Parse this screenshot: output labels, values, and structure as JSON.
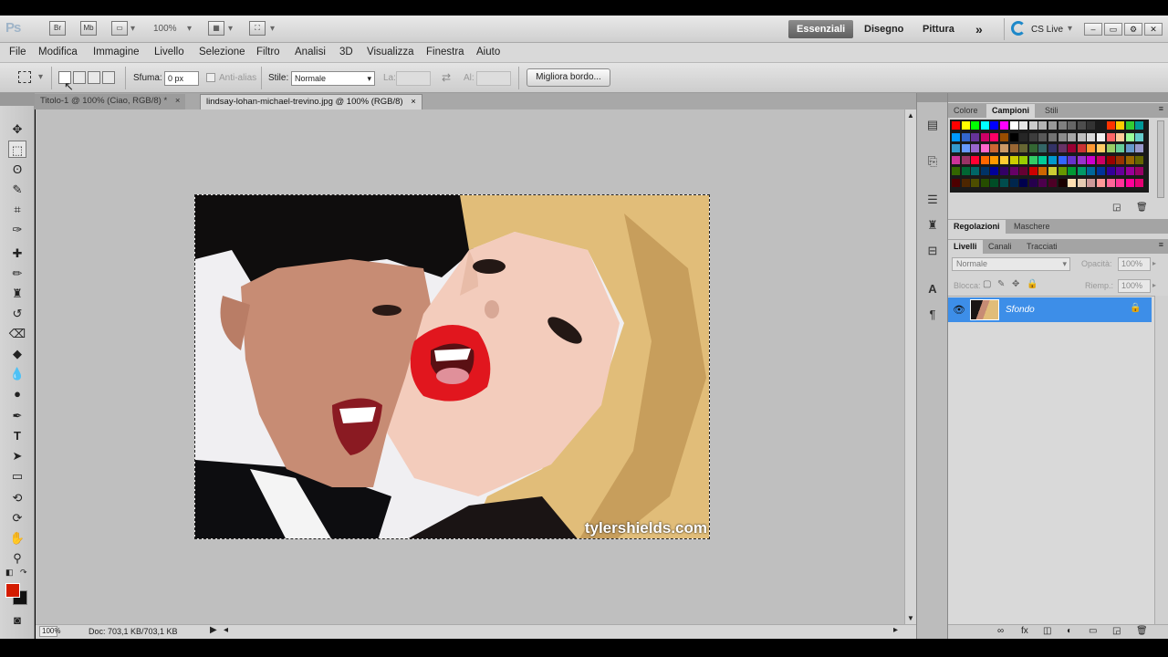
{
  "app": {
    "logo": "Ps",
    "zoom": "100%",
    "workspaces": [
      "Essenziali",
      "Disegno",
      "Pittura"
    ],
    "more": "»",
    "cs_live": "CS Live",
    "icons": [
      "bridge-icon",
      "mini-bridge-icon",
      "screen-mode-icon",
      "arrange-icon",
      "extras-icon"
    ]
  },
  "menu": [
    "File",
    "Modifica",
    "Immagine",
    "Livello",
    "Selezione",
    "Filtro",
    "Analisi",
    "3D",
    "Visualizza",
    "Finestra",
    "Aiuto"
  ],
  "options": {
    "feather_label": "Sfuma:",
    "feather_value": "0 px",
    "antialias_label": "Anti-alias",
    "style_label": "Stile:",
    "style_value": "Normale",
    "width_label": "La:",
    "height_label": "Al:",
    "refine_button": "Migliora bordo..."
  },
  "tabs": [
    {
      "label": "Titolo-1 @ 100% (Ciao, RGB/8) *",
      "close": "×"
    },
    {
      "label": "lindsay-lohan-michael-trevino.jpg @ 100% (RGB/8)",
      "close": "×"
    }
  ],
  "canvas": {
    "watermark": "tylershields.com"
  },
  "status": {
    "doc": "Doc: 703,1 KB/703,1 KB",
    "zoom_field": "100%"
  },
  "colors_panel": {
    "tabs": [
      "Colore",
      "Campioni",
      "Stili"
    ],
    "swatch_colors": [
      "#ff0000",
      "#ffff00",
      "#00ff00",
      "#00ffff",
      "#0000ff",
      "#ff00ff",
      "#ffffff",
      "#e6e6e6",
      "#cccccc",
      "#b3b3b3",
      "#999999",
      "#808080",
      "#666666",
      "#4d4d4d",
      "#333333",
      "#1a1a1a",
      "#ff3300",
      "#ffcc00",
      "#33cc33",
      "#009999",
      "#0099ff",
      "#3366cc",
      "#663399",
      "#cc0066",
      "#ff0066",
      "#994d00",
      "#000000",
      "#262626",
      "#3d3d3d",
      "#595959",
      "#737373",
      "#8c8c8c",
      "#a6a6a6",
      "#bfbfbf",
      "#d9d9d9",
      "#f2f2f2",
      "#ff6666",
      "#ffcc99",
      "#99ff99",
      "#66cccc",
      "#3399cc",
      "#6699ff",
      "#9966cc",
      "#ff66cc",
      "#cc6633",
      "#cc9966",
      "#996633",
      "#666633",
      "#336633",
      "#336666",
      "#333366",
      "#663366",
      "#990033",
      "#cc3333",
      "#ff9933",
      "#ffcc66",
      "#99cc66",
      "#66cc99",
      "#6699cc",
      "#9999cc",
      "#cc3399",
      "#993366",
      "#ff0033",
      "#ff6600",
      "#ff9900",
      "#ffcc33",
      "#cccc00",
      "#99cc00",
      "#33cc66",
      "#00cc99",
      "#0099cc",
      "#3366ff",
      "#6633cc",
      "#9933cc",
      "#cc00cc",
      "#cc0066",
      "#990000",
      "#993300",
      "#996600",
      "#666600",
      "#336600",
      "#006633",
      "#006666",
      "#003366",
      "#000099",
      "#330066",
      "#660066",
      "#660033",
      "#cc0000",
      "#cc6600",
      "#cccc33",
      "#669900",
      "#009933",
      "#009966",
      "#006699",
      "#003399",
      "#330099",
      "#660099",
      "#990099",
      "#990066",
      "#4d0000",
      "#4d2600",
      "#4d4d00",
      "#264d00",
      "#004d26",
      "#004d4d",
      "#00264d",
      "#00004d",
      "#26004d",
      "#4d004d",
      "#4d0026",
      "#1a0000",
      "#ffe0b3",
      "#e6ccb3",
      "#cc9999",
      "#ff9999",
      "#ff6699",
      "#ff3399",
      "#ff0099",
      "#e60073"
    ]
  },
  "adjust_panel": {
    "tabs": [
      "Regolazioni",
      "Maschere"
    ]
  },
  "layers_panel": {
    "tabs": [
      "Livelli",
      "Canali",
      "Tracciati"
    ],
    "blend_mode": "Normale",
    "opacity_label": "Opacità:",
    "opacity_value": "100%",
    "lock_label": "Blocca:",
    "fill_label": "Riemp.:",
    "fill_value": "100%",
    "layer_name": "Sfondo"
  }
}
